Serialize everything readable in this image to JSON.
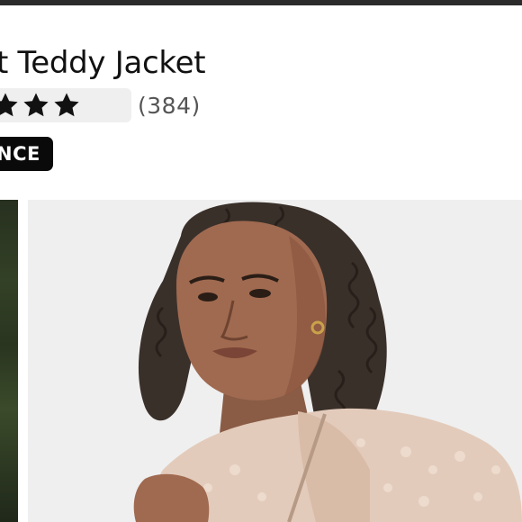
{
  "product": {
    "title": "t Teddy Jacket",
    "rating": {
      "stars_visible": 3,
      "review_count": "(384)"
    },
    "badge": "NCE"
  },
  "colors": {
    "top_bar": "#2b2b2b",
    "badge_bg": "#0a0a0a",
    "badge_text": "#ffffff",
    "star": "#111111",
    "rating_track": "#efefef"
  },
  "gallery": {
    "main_image": "model-in-teddy-jacket-photo",
    "thumbnail": "green-foliage-thumbnail"
  }
}
